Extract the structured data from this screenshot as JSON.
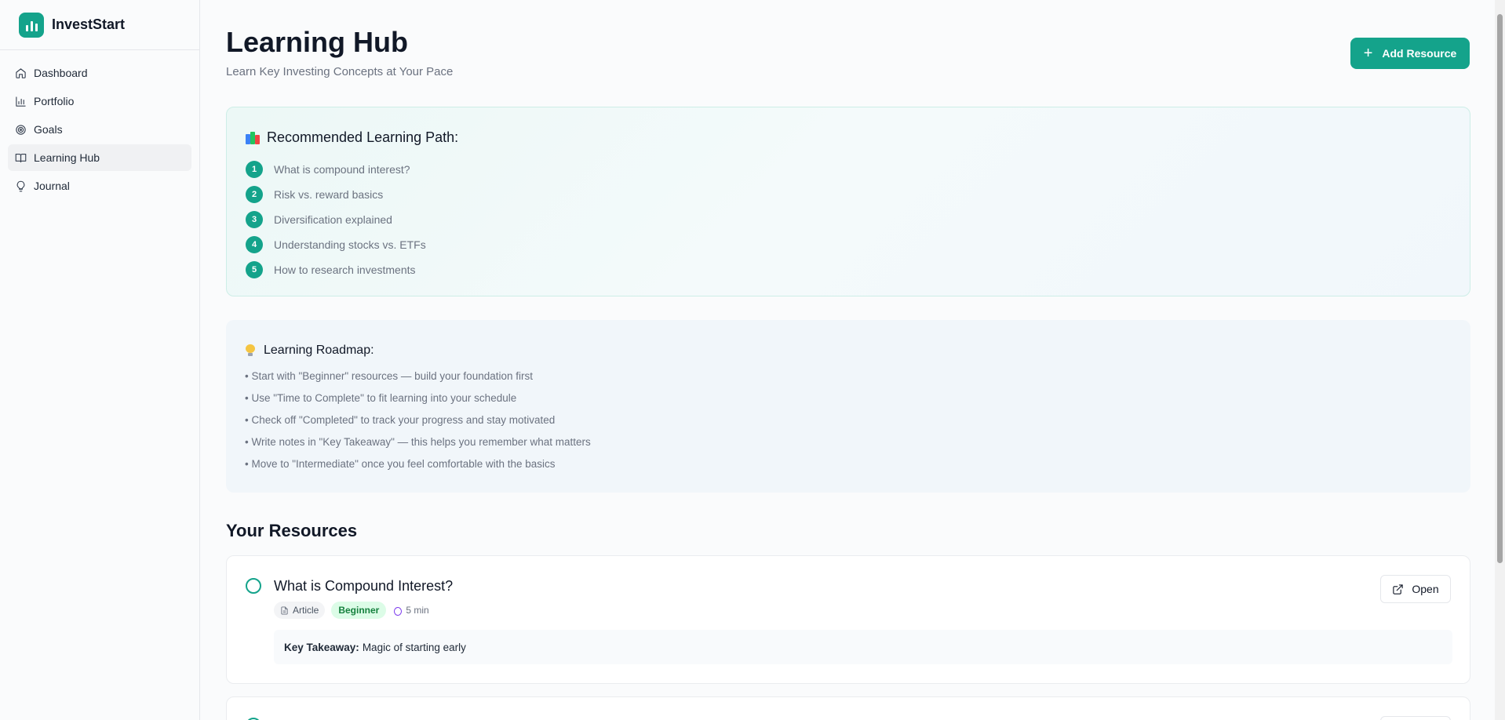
{
  "app": {
    "name": "InvestStart"
  },
  "sidebar": {
    "items": [
      {
        "label": "Dashboard",
        "icon": "home-icon",
        "active": false
      },
      {
        "label": "Portfolio",
        "icon": "bar-chart-icon",
        "active": false
      },
      {
        "label": "Goals",
        "icon": "target-icon",
        "active": false
      },
      {
        "label": "Learning Hub",
        "icon": "book-open-icon",
        "active": true
      },
      {
        "label": "Journal",
        "icon": "lightbulb-icon",
        "active": false
      }
    ]
  },
  "header": {
    "title": "Learning Hub",
    "subtitle": "Learn Key Investing Concepts at Your Pace",
    "add_button_label": "Add Resource"
  },
  "learning_path": {
    "heading": "Recommended Learning Path:",
    "steps": [
      {
        "num": "1",
        "label": "What is compound interest?"
      },
      {
        "num": "2",
        "label": "Risk vs. reward basics"
      },
      {
        "num": "3",
        "label": "Diversification explained"
      },
      {
        "num": "4",
        "label": "Understanding stocks vs. ETFs"
      },
      {
        "num": "5",
        "label": "How to research investments"
      }
    ]
  },
  "roadmap": {
    "heading": "Learning Roadmap:",
    "tips": [
      "• Start with \"Beginner\" resources — build your foundation first",
      "• Use \"Time to Complete\" to fit learning into your schedule",
      "• Check off \"Completed\" to track your progress and stay motivated",
      "• Write notes in \"Key Takeaway\" — this helps you remember what matters",
      "• Move to \"Intermediate\" once you feel comfortable with the basics"
    ]
  },
  "resources": {
    "heading": "Your Resources",
    "items": [
      {
        "title": "What is Compound Interest?",
        "type": "Article",
        "level": "Beginner",
        "duration": "5 min",
        "takeaway_label": "Key Takeaway:",
        "takeaway": "Magic of starting early",
        "open_label": "Open"
      }
    ]
  },
  "colors": {
    "accent": "#14a38b",
    "beginner_bg": "#dcfce7",
    "beginner_text": "#15803d"
  }
}
